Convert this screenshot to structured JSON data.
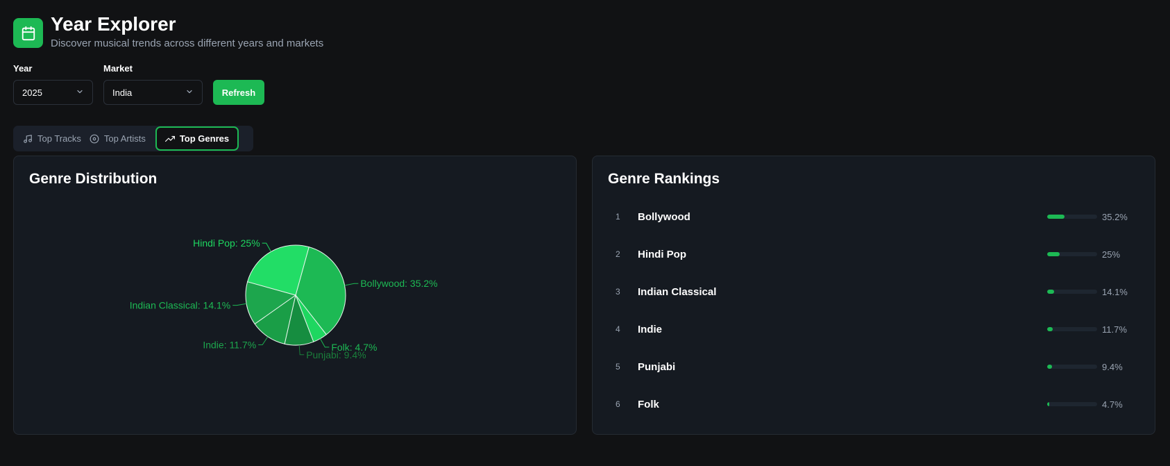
{
  "header": {
    "title": "Year Explorer",
    "subtitle": "Discover musical trends across different years and markets",
    "logo_icon": "calendar-icon"
  },
  "filters": {
    "year_label": "Year",
    "year_value": "2025",
    "market_label": "Market",
    "market_value": "India",
    "refresh_label": "Refresh"
  },
  "tabs": [
    {
      "label": "Top Tracks",
      "icon": "music-note-icon",
      "active": false
    },
    {
      "label": "Top Artists",
      "icon": "disc-icon",
      "active": false
    },
    {
      "label": "Top Genres",
      "icon": "trending-up-icon",
      "active": true
    }
  ],
  "distribution": {
    "title": "Genre Distribution"
  },
  "chart_data": {
    "type": "pie",
    "slices": [
      {
        "label": "Bollywood: 35.2%",
        "name": "Bollywood",
        "value": 35.2,
        "color": "#1db954"
      },
      {
        "label": "Folk: 4.7%",
        "name": "Folk",
        "value": 4.7,
        "color": "#1ed760"
      },
      {
        "label": "Punjabi: 9.4%",
        "name": "Punjabi",
        "value": 9.4,
        "color": "#168d40"
      },
      {
        "label": "Indie: 11.7%",
        "name": "Indie",
        "value": 11.7,
        "color": "#1a9e47"
      },
      {
        "label": "Indian Classical: 14.1%",
        "name": "Indian Classical",
        "value": 14.1,
        "color": "#1da64d"
      },
      {
        "label": "Hindi Pop: 25%",
        "name": "Hindi Pop",
        "value": 25,
        "color": "#22dd66"
      }
    ]
  },
  "rankings": {
    "title": "Genre Rankings",
    "items": [
      {
        "rank": "1",
        "name": "Bollywood",
        "pct": "35.2%",
        "value": 35.2
      },
      {
        "rank": "2",
        "name": "Hindi Pop",
        "pct": "25%",
        "value": 25
      },
      {
        "rank": "3",
        "name": "Indian Classical",
        "pct": "14.1%",
        "value": 14.1
      },
      {
        "rank": "4",
        "name": "Indie",
        "pct": "11.7%",
        "value": 11.7
      },
      {
        "rank": "5",
        "name": "Punjabi",
        "pct": "9.4%",
        "value": 9.4
      },
      {
        "rank": "6",
        "name": "Folk",
        "pct": "4.7%",
        "value": 4.7
      }
    ]
  },
  "colors": {
    "accent": "#1db954",
    "background": "#111214",
    "card": "#151a21"
  }
}
